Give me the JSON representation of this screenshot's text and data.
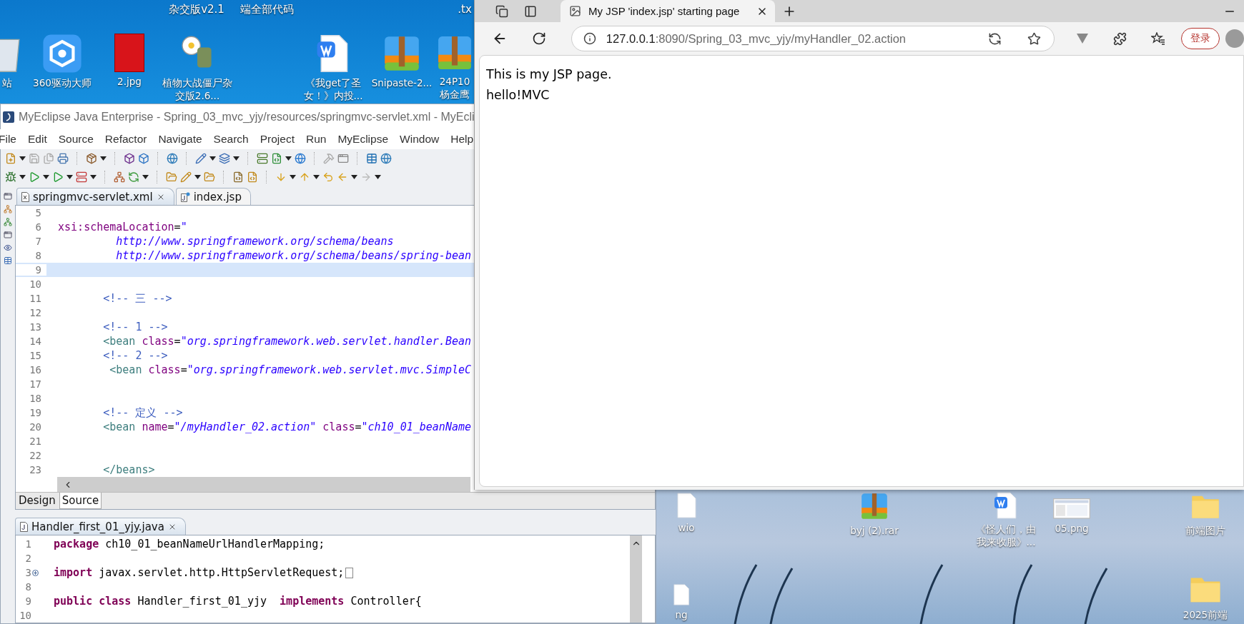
{
  "desktop": {
    "top_labels": [
      "杂交版v2.1",
      "端全部代码",
      ".tx"
    ],
    "icons": [
      {
        "kind": "recycle",
        "label": "站"
      },
      {
        "kind": "app",
        "label": "360驱动大师"
      },
      {
        "kind": "photo",
        "label": "2.jpg"
      },
      {
        "kind": "game",
        "label": "植物大战僵尸杂交版2.6..."
      },
      {
        "kind": "doc",
        "label": "《我get了圣女！》内投..."
      },
      {
        "kind": "zip",
        "label": "Snipaste-2..."
      },
      {
        "kind": "zip",
        "label": "24P10杨金鹰"
      }
    ],
    "lower_icons": [
      {
        "kind": "page",
        "label": "wio"
      },
      {
        "kind": "zip",
        "label": "byj (2).rar"
      },
      {
        "kind": "doc",
        "label": "《怪人们，由我来收服》..."
      },
      {
        "kind": "image",
        "label": "05.png"
      },
      {
        "kind": "folder",
        "label": "前端图片"
      },
      {
        "kind": "page",
        "label": "ng"
      },
      {
        "kind": "folder",
        "label": "2025前端"
      }
    ]
  },
  "ide": {
    "title": "MyEclipse Java Enterprise - Spring_03_mvc_yjy/resources/springmvc-servlet.xml - MyEcli",
    "menu": [
      "File",
      "Edit",
      "Source",
      "Refactor",
      "Navigate",
      "Search",
      "Project",
      "Run",
      "MyEclipse",
      "Window",
      "Help"
    ],
    "editor_tabs": [
      {
        "label": "springmvc-servlet.xml",
        "kind": "xml",
        "selected": true
      },
      {
        "label": "index.jsp",
        "kind": "jsp",
        "selected": false
      }
    ],
    "xml_editor": {
      "lines": [
        {
          "number": "5",
          "current": false
        },
        {
          "number": "6",
          "current": false,
          "tokens": [
            {
              "kind": "attr",
              "text": " xsi:schemaLocation"
            },
            {
              "kind": "plain",
              "text": "="
            },
            {
              "kind": "string",
              "text": "\""
            }
          ]
        },
        {
          "number": "7",
          "current": false,
          "tokens": [
            {
              "kind": "string",
              "text": "          http://www.springframework.org/schema/beans"
            }
          ]
        },
        {
          "number": "8",
          "current": false,
          "tokens": [
            {
              "kind": "string",
              "text": "          http://www.springframework.org/schema/beans/spring-bean"
            }
          ]
        },
        {
          "number": "9",
          "current": true
        },
        {
          "number": "10",
          "current": false
        },
        {
          "number": "11",
          "current": false,
          "tokens": [
            {
              "kind": "comment",
              "text": "        <!-- 三 -->"
            }
          ]
        },
        {
          "number": "12",
          "current": false
        },
        {
          "number": "13",
          "current": false,
          "tokens": [
            {
              "kind": "comment",
              "text": "        <!-- 1 -->"
            }
          ]
        },
        {
          "number": "14",
          "current": false,
          "tokens": [
            {
              "kind": "tag",
              "text": "        <bean"
            },
            {
              "kind": "attr",
              "text": " class"
            },
            {
              "kind": "plain",
              "text": "="
            },
            {
              "kind": "string",
              "text": "\"org.springframework.web.servlet.handler.Bean"
            }
          ]
        },
        {
          "number": "15",
          "current": false,
          "tokens": [
            {
              "kind": "comment",
              "text": "        <!-- 2 -->"
            }
          ]
        },
        {
          "number": "16",
          "current": false,
          "tokens": [
            {
              "kind": "tag",
              "text": "         <bean"
            },
            {
              "kind": "attr",
              "text": " class"
            },
            {
              "kind": "plain",
              "text": "="
            },
            {
              "kind": "string",
              "text": "\"org.springframework.web.servlet.mvc.SimpleC"
            }
          ]
        },
        {
          "number": "17",
          "current": false
        },
        {
          "number": "18",
          "current": false
        },
        {
          "number": "19",
          "current": false,
          "tokens": [
            {
              "kind": "comment",
              "text": "        <!-- 定义 -->"
            }
          ]
        },
        {
          "number": "20",
          "current": false,
          "tokens": [
            {
              "kind": "tag",
              "text": "        <bean"
            },
            {
              "kind": "attr",
              "text": " name"
            },
            {
              "kind": "plain",
              "text": "="
            },
            {
              "kind": "string",
              "text": "\"/myHandler_02.action\""
            },
            {
              "kind": "attr",
              "text": " class"
            },
            {
              "kind": "plain",
              "text": "="
            },
            {
              "kind": "string",
              "text": "\"ch10_01_beanName"
            }
          ]
        },
        {
          "number": "21",
          "current": false
        },
        {
          "number": "22",
          "current": false
        },
        {
          "number": "23",
          "current": false,
          "tokens": [
            {
              "kind": "tag",
              "text": "        </beans>"
            }
          ]
        }
      ]
    },
    "view_tabs": [
      {
        "label": "Design",
        "selected": false
      },
      {
        "label": "Source",
        "selected": true
      }
    ],
    "java_editor": {
      "tab": {
        "label": "Handler_first_01_yjy.java"
      },
      "lines": [
        {
          "number": "1",
          "folded": false,
          "tokens": [
            {
              "kind": "keyword",
              "text": "package"
            },
            {
              "kind": "plain",
              "text": " ch10_01_beanNameUrlHandlerMapping;"
            }
          ]
        },
        {
          "number": "2",
          "folded": false
        },
        {
          "number": "3",
          "folded": true,
          "tokens": [
            {
              "kind": "keyword",
              "text": "import"
            },
            {
              "kind": "plain",
              "text": " javax.servlet.http.HttpServletRequest;"
            }
          ]
        },
        {
          "number": "8",
          "folded": false
        },
        {
          "number": "9",
          "folded": false,
          "tokens": [
            {
              "kind": "keyword",
              "text": "public"
            },
            {
              "kind": "keyword",
              "text": " class"
            },
            {
              "kind": "plain",
              "text": " Handler_first_01_yjy  "
            },
            {
              "kind": "keyword",
              "text": "implements"
            },
            {
              "kind": "plain",
              "text": " Controller{"
            }
          ]
        },
        {
          "number": "10",
          "folded": false
        }
      ]
    }
  },
  "browser": {
    "tab": {
      "title": "My JSP 'index.jsp' starting page"
    },
    "address": {
      "host": "127.0.0.1",
      "path": ":8090/Spring_03_mvc_yjy/myHandler_02.action"
    },
    "login_button": "登录",
    "page": {
      "lines": [
        "This is my JSP page.",
        "hello!MVC"
      ]
    }
  }
}
